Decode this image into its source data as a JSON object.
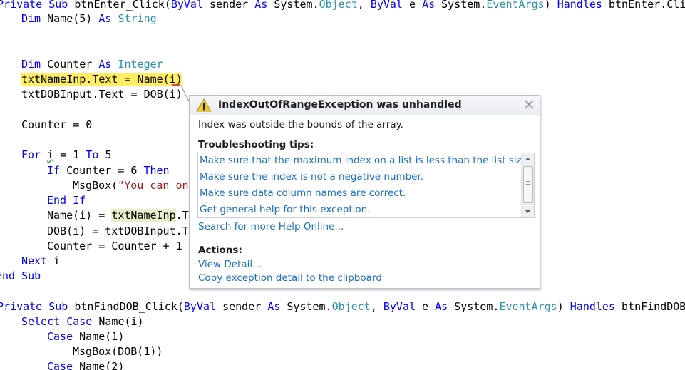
{
  "code": {
    "l1": {
      "a": "Private",
      "b": " ",
      "c": "Sub",
      "d": " btnEnter_Click(",
      "e": "ByVal",
      "f": " sender ",
      "g": "As",
      "h": " System.",
      "i": "Object",
      "j": ", ",
      "k": "ByVal",
      "l": " e ",
      "m": "As",
      "n": " System.",
      "o": "EventArgs",
      "p": ") ",
      "q": "Handles",
      "r": " btnEnter.Clic"
    },
    "l2": {
      "a": "Dim",
      "b": " Name(5) ",
      "c": "As",
      "d": " ",
      "e": "String"
    },
    "l3": {
      "a": "Dim",
      "b": " Counter ",
      "c": "As",
      "d": " ",
      "e": "Integer"
    },
    "l4": {
      "a": "txtNameInp.Text = Name(i)"
    },
    "l5": {
      "a": "txtDOBInput.Text = DOB(i)"
    },
    "l6": {
      "a": "Counter = 0"
    },
    "l7": {
      "a": "For",
      "b": " ",
      "c": "i",
      "d": " = 1 ",
      "e": "To",
      "f": " 5"
    },
    "l8": {
      "a": "If",
      "b": " Counter = 6 ",
      "c": "Then"
    },
    "l9": {
      "a": "MsgBox(",
      "b": "\"You can on"
    },
    "l10": {
      "a": "End",
      "b": " ",
      "c": "If"
    },
    "l11": {
      "a": "Name(i) = ",
      "b": "txtNameInp",
      "c": ".T"
    },
    "l12": {
      "a": "DOB(i) = txtDOBInput.T"
    },
    "l13": {
      "a": "Counter = Counter + 1"
    },
    "l14": {
      "a": "Next",
      "b": " i"
    },
    "l15": {
      "a": "End",
      "b": " ",
      "c": "Sub"
    },
    "l16": {
      "a": "Private",
      "b": " ",
      "c": "Sub",
      "d": " btnFindDOB_Click(",
      "e": "ByVal",
      "f": " sender ",
      "g": "As",
      "h": " System.",
      "i": "Object",
      "j": ", ",
      "k": "ByVal",
      "l": " e ",
      "m": "As",
      "n": " System.",
      "o": "EventArgs",
      "p": ") ",
      "q": "Handles",
      "r": " btnFindDOB."
    },
    "l17": {
      "a": "Select",
      "b": " ",
      "c": "Case",
      "d": " Name(i)"
    },
    "l18": {
      "a": "Case",
      "b": " Name(1)"
    },
    "l19": {
      "a": "MsgBox(DOB(1))"
    },
    "l20": {
      "a": "Case",
      "b": " Name(2)"
    }
  },
  "exception": {
    "title": "IndexOutOfRangeException was unhandled",
    "message": "Index was outside the bounds of the array.",
    "tips_heading": "Troubleshooting tips:",
    "tips": [
      "Make sure that the maximum index on a list is less than the list size.",
      "Make sure the index is not a negative number.",
      "Make sure data column names are correct.",
      "Get general help for this exception."
    ],
    "search_link": "Search for more Help Online...",
    "actions_heading": "Actions:",
    "actions": [
      "View Detail...",
      "Copy exception detail to the clipboard"
    ]
  },
  "colors": {
    "keyword": "#0000ff",
    "type": "#2b91af",
    "string": "#a31515",
    "current_statement_highlight": "#ffee62",
    "reference_highlight": "#e9eec8",
    "link": "#1a6fc4"
  },
  "icons": {
    "warning": "warning-icon",
    "close": "close-icon"
  }
}
